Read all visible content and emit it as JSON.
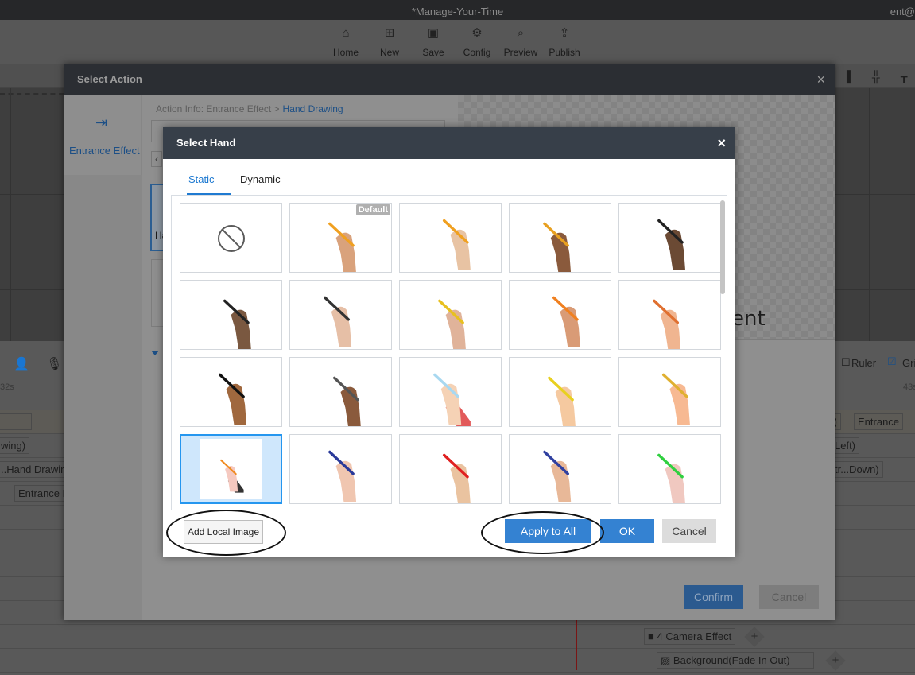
{
  "window": {
    "title": "*Manage-Your-Time",
    "user": "ent@"
  },
  "toolbar": {
    "items": [
      {
        "label": "Home",
        "icon": "home-icon"
      },
      {
        "label": "New",
        "icon": "new-icon"
      },
      {
        "label": "Save",
        "icon": "save-icon"
      },
      {
        "label": "Config",
        "icon": "config-icon"
      },
      {
        "label": "Preview",
        "icon": "preview-icon"
      },
      {
        "label": "Publish",
        "icon": "publish-icon"
      }
    ]
  },
  "timeline": {
    "time_left": "32s",
    "time_right": "43s",
    "ruler_label": "Ruler",
    "ruler_checked": false,
    "grid_label": "Gri",
    "grid_checked": true,
    "chips": {
      "wing": "wing)",
      "hand_drawing": "..Hand Drawir",
      "entrance_left": "Entrance E",
      "t_right": "t)",
      "entrance_right": "Entrance",
      "left": "Left)",
      "tr_down": "tr...Down)",
      "camera": "4  Camera Effect",
      "background": "Background(Fade In Out)"
    }
  },
  "action_dialog": {
    "title": "Select Action",
    "close": "×",
    "side_item": "Entrance Effect",
    "breadcrumb_prefix": "Action Info: Entrance Effect >",
    "breadcrumb_current": "Hand Drawing",
    "thumb_label": "Ha",
    "preview_text": "ent",
    "confirm": "Confirm",
    "cancel": "Cancel"
  },
  "hand_dialog": {
    "title": "Select Hand",
    "close": "×",
    "tabs": [
      {
        "label": "Static",
        "active": true
      },
      {
        "label": "Dynamic",
        "active": false
      }
    ],
    "default_badge": "Default",
    "tiles": [
      {
        "name": "none",
        "type": "none"
      },
      {
        "name": "hand-pencil-default",
        "default": true,
        "skin": "#d9a27c",
        "tool": "#f0a020"
      },
      {
        "name": "hand-pencil-2",
        "skin": "#e8c3a3",
        "tool": "#f0a020"
      },
      {
        "name": "hand-pencil-3",
        "skin": "#8a5a3c",
        "tool": "#e8a020"
      },
      {
        "name": "hand-marker-4",
        "skin": "#6b4a34",
        "tool": "#222222"
      },
      {
        "name": "hand-marker-5",
        "skin": "#7a5840",
        "tool": "#222222"
      },
      {
        "name": "hand-pen-6",
        "skin": "#e6bfa6",
        "tool": "#333333"
      },
      {
        "name": "hand-pencil-7",
        "skin": "#e0b39a",
        "tool": "#e8c020"
      },
      {
        "name": "hand-pencil-8",
        "skin": "#d99b76",
        "tool": "#f08020"
      },
      {
        "name": "hand-pencil-9",
        "skin": "#f0b590",
        "tool": "#e07030"
      },
      {
        "name": "hand-marker-10",
        "skin": "#a0683e",
        "tool": "#111111"
      },
      {
        "name": "hand-pen-11",
        "skin": "#8a5a3c",
        "tool": "#555555"
      },
      {
        "name": "cartoon-hand-pen-12",
        "skin": "#f5d2b5",
        "tool": "#a8d8f0",
        "sleeve": "#e25a5a"
      },
      {
        "name": "cartoon-hand-pencil-13",
        "skin": "#f5c9a0",
        "tool": "#e8d020"
      },
      {
        "name": "cartoon-hand-pencil-14",
        "skin": "#f7b992",
        "tool": "#e0b030"
      },
      {
        "name": "cartoon-hand-pen-15",
        "skin": "#f5c9c0",
        "tool": "#f08a20",
        "sleeve": "#333333",
        "selected": true
      },
      {
        "name": "hand-blue-pen-16",
        "skin": "#f0c6b0",
        "tool": "#2a3a9a"
      },
      {
        "name": "hand-red-pen-17",
        "skin": "#eac3a0",
        "tool": "#e02020"
      },
      {
        "name": "hand-blue-pen-18",
        "skin": "#e8b898",
        "tool": "#3040a0"
      },
      {
        "name": "hand-green-pen-19",
        "skin": "#f0c8c0",
        "tool": "#30d040"
      }
    ],
    "add_local_image": "Add Local Image",
    "apply_to_all": "Apply to All",
    "ok": "OK",
    "cancel": "Cancel"
  },
  "colors": {
    "accent": "#3482d2",
    "selected_tile_border": "#2596ef",
    "selected_tile_bg": "#cfe7fc",
    "dialog_header": "#373f49"
  }
}
